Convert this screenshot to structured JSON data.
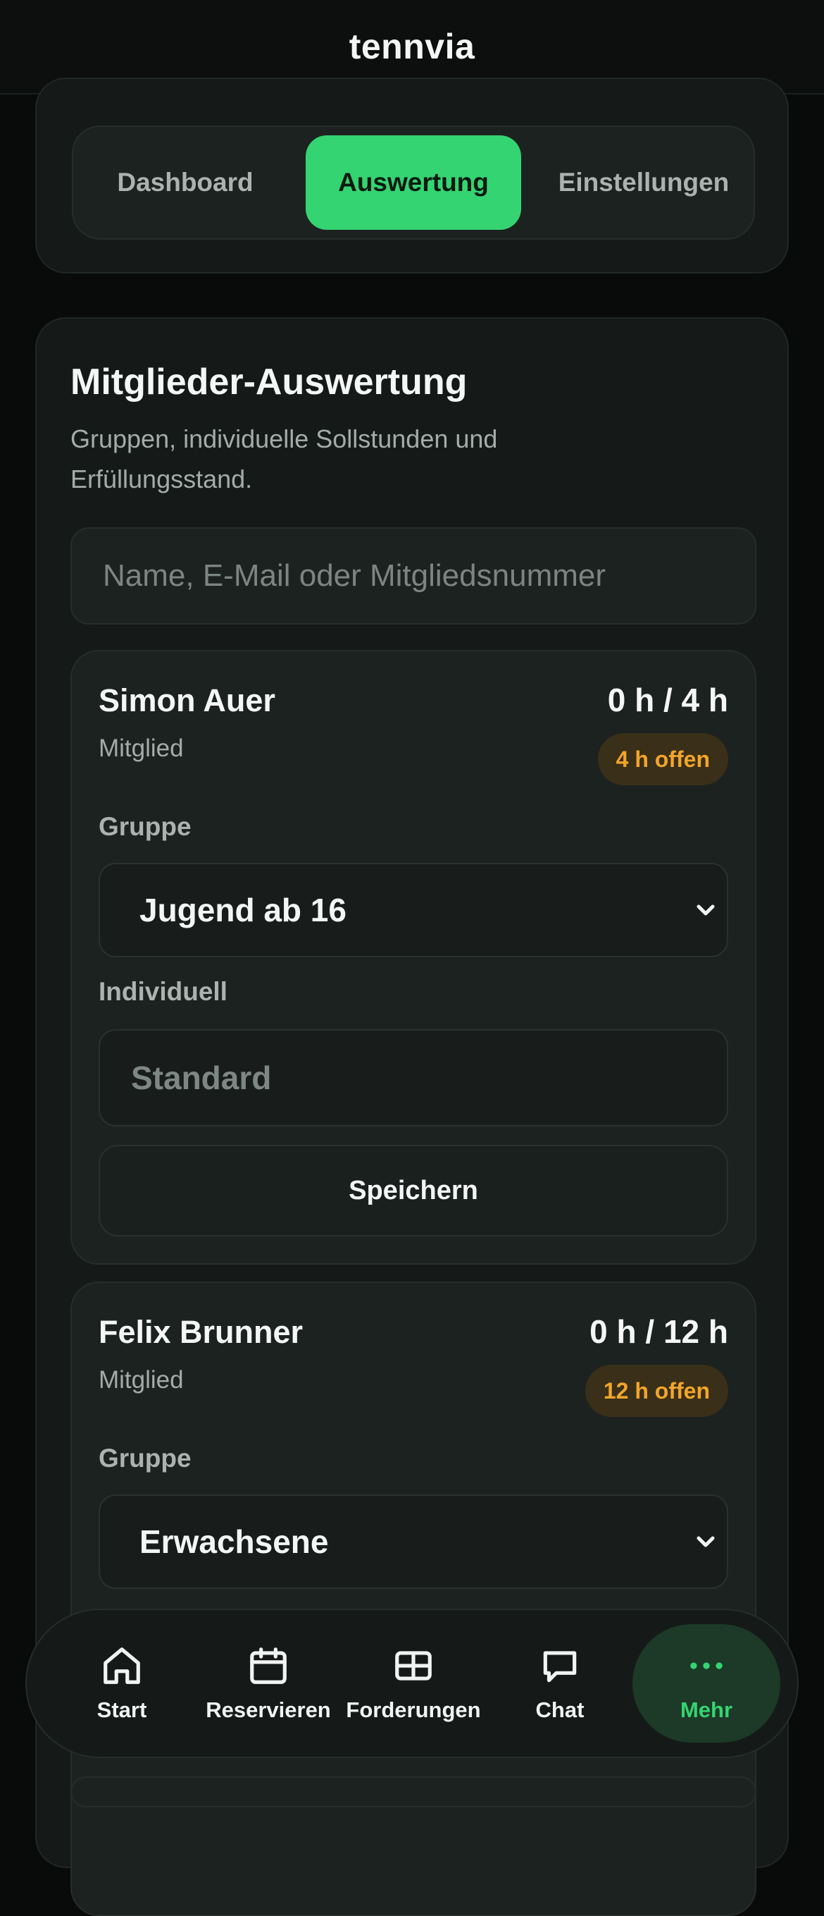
{
  "app": {
    "title": "tennvia"
  },
  "tabs": [
    {
      "label": "Dashboard",
      "active": false
    },
    {
      "label": "Auswertung",
      "active": true
    },
    {
      "label": "Einstellungen",
      "active": false
    }
  ],
  "section": {
    "title": "Mitglieder-Auswertung",
    "subtitle": "Gruppen, individuelle Sollstunden und Erfüllungsstand."
  },
  "search": {
    "placeholder": "Name, E-Mail oder Mitgliedsnummer",
    "value": ""
  },
  "members": [
    {
      "name": "Simon Auer",
      "role": "Mitglied",
      "hours": "0 h / 4 h",
      "badge": "4 h offen",
      "group_label": "Gruppe",
      "group_value": "Jugend ab 16",
      "individual_label": "Individuell",
      "individual_placeholder": "Standard",
      "save_label": "Speichern"
    },
    {
      "name": "Felix Brunner",
      "role": "Mitglied",
      "hours": "0 h / 12 h",
      "badge": "12 h offen",
      "group_label": "Gruppe",
      "group_value": "Erwachsene"
    }
  ],
  "nav": [
    {
      "label": "Start",
      "icon": "home-icon"
    },
    {
      "label": "Reservieren",
      "icon": "calendar-icon"
    },
    {
      "label": "Forderungen",
      "icon": "grid-icon"
    },
    {
      "label": "Chat",
      "icon": "chat-icon"
    },
    {
      "label": "Mehr",
      "icon": "more-icon",
      "active": true
    }
  ],
  "colors": {
    "accent": "#35d472",
    "badge_text": "#f2a52a",
    "background": "#080b0a",
    "card": "#151a18"
  }
}
